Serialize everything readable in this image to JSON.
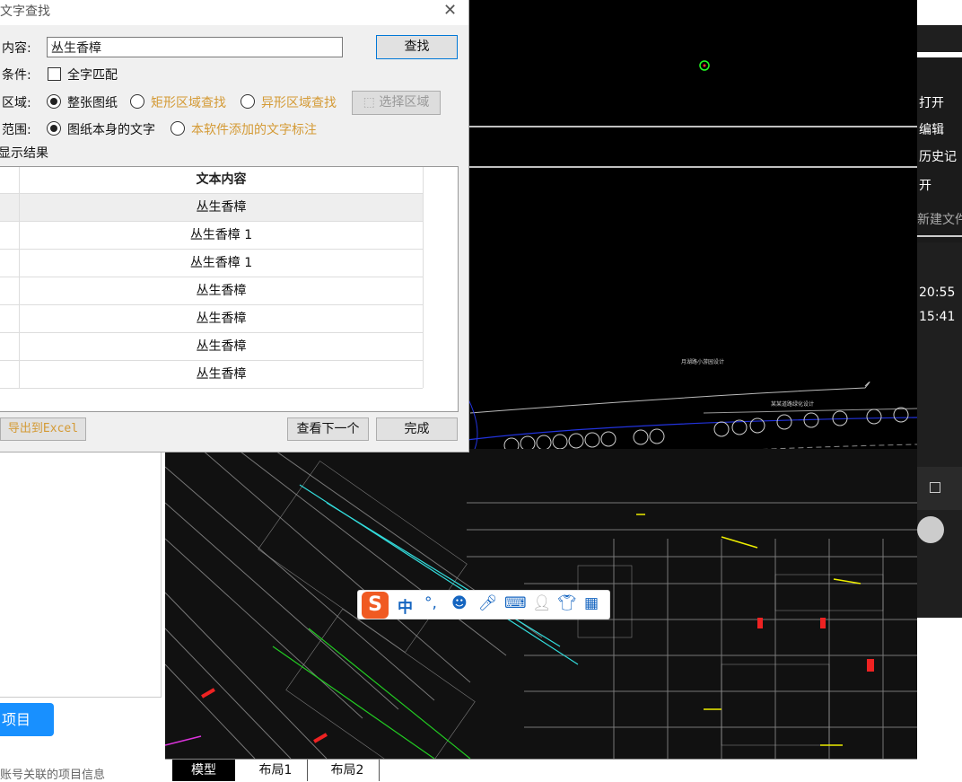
{
  "dialog": {
    "title": "文字查找",
    "content_label": "内容:",
    "content_value": "丛生香樟",
    "find_button": "查找",
    "condition_label": "条件:",
    "full_match_label": "全字匹配",
    "area_label": "区域:",
    "area_options": [
      "整张图纸",
      "矩形区域查找",
      "异形区域查找"
    ],
    "select_area_button": "选择区域",
    "scope_label": "范围:",
    "scope_options": [
      "图纸本身的文字",
      "本软件添加的文字标注"
    ],
    "show_results_label": "显示结果",
    "table": {
      "header": "文本内容",
      "rows": [
        "丛生香樟",
        "丛生香樟 1",
        "丛生香樟 1",
        "丛生香樟",
        "丛生香樟",
        "丛生香樟",
        "丛生香樟"
      ]
    },
    "export_button": "导出到Excel",
    "next_button": "查看下一个",
    "done_button": "完成"
  },
  "left_panel": {
    "project_button": "项目",
    "project_info": "账号关联的项目信息"
  },
  "tabs": [
    "模型",
    "布局1",
    "布局2"
  ],
  "right_panel": {
    "menu": [
      "打开",
      "编辑",
      "历史记",
      "开",
      "新建文件"
    ],
    "times": [
      "20:55",
      "15:41"
    ]
  },
  "cad_annotations": [
    "月湖路小游园设计",
    "某某道路绿化设计"
  ],
  "ime_toolbar": {
    "logo": "S",
    "mode": "中",
    "punct": "°,"
  }
}
